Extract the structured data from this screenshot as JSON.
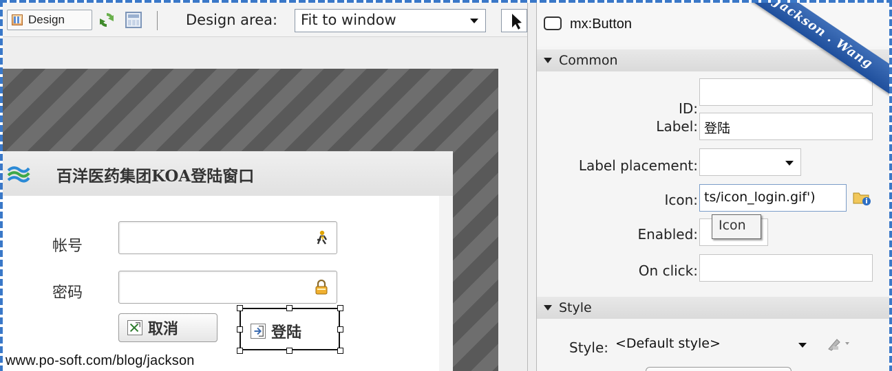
{
  "toolbar": {
    "design_label": "Design",
    "design_area_label": "Design area:",
    "design_area_value": "Fit to window"
  },
  "dialog": {
    "title": "百洋医药集团KOA登陆窗口",
    "account_label": "帐号",
    "password_label": "密码",
    "cancel_label": "取消",
    "login_label": "登陆"
  },
  "watermark": {
    "url": "www.po-soft.com/blog/jackson",
    "ribbon": "Jackson . Wang"
  },
  "properties": {
    "component": "mx:Button",
    "common_section": "Common",
    "style_section": "Style",
    "id_label": "ID:",
    "id_value": "",
    "label_label": "Label:",
    "label_value": "登陆",
    "label_placement_label": "Label placement:",
    "label_placement_value": "",
    "icon_label": "Icon:",
    "icon_value": "ts/icon_login.gif')",
    "icon_tooltip": "Icon",
    "enabled_label": "Enabled:",
    "on_click_label": "On click:",
    "on_click_value": "",
    "style_label": "Style:",
    "style_value": "<Default style>"
  },
  "colors": {
    "frame_dash": "#3a78c8",
    "ribbon": "#2a5aa8",
    "canvas_stripe_dark": "#595959",
    "canvas_stripe_light": "#6e6e6e"
  },
  "icons": [
    "design-view-icon",
    "refresh-icon",
    "layout-icon",
    "pointer-icon",
    "company-logo-icon",
    "user-icon",
    "lock-icon",
    "cancel-icon",
    "login-icon",
    "button-component-icon",
    "folder-browse-icon",
    "style-edit-icon"
  ]
}
